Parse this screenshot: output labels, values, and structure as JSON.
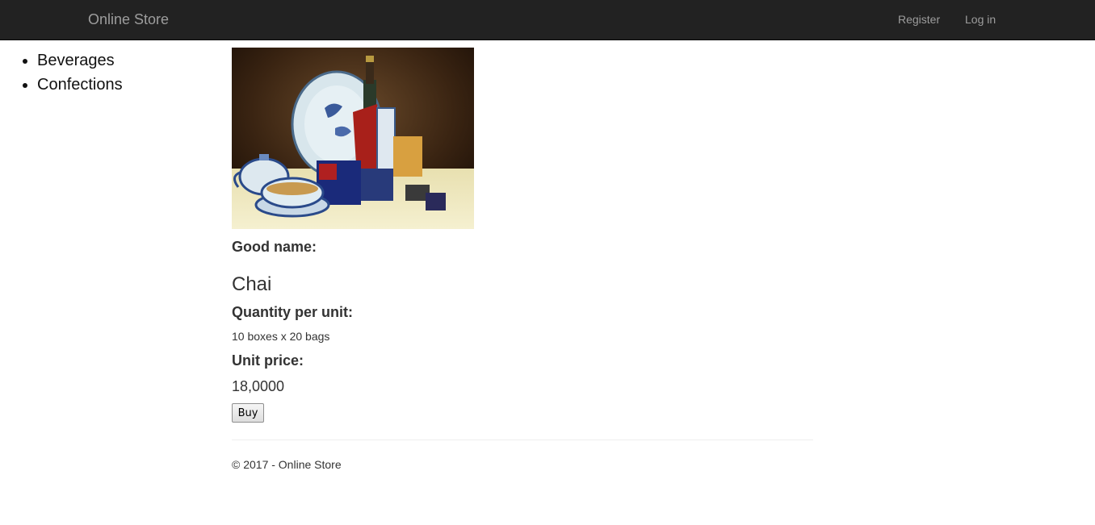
{
  "navbar": {
    "brand": "Online Store",
    "register": "Register",
    "login": "Log in"
  },
  "categories": [
    {
      "label": "Beverages"
    },
    {
      "label": "Confections"
    }
  ],
  "product": {
    "name_label": "Good name:",
    "name": "Chai",
    "quantity_label": "Quantity per unit:",
    "quantity": "10 boxes x 20 bags",
    "price_label": "Unit price:",
    "price": "18,0000",
    "buy_label": "Buy"
  },
  "footer": {
    "text": "© 2017 - Online Store"
  }
}
